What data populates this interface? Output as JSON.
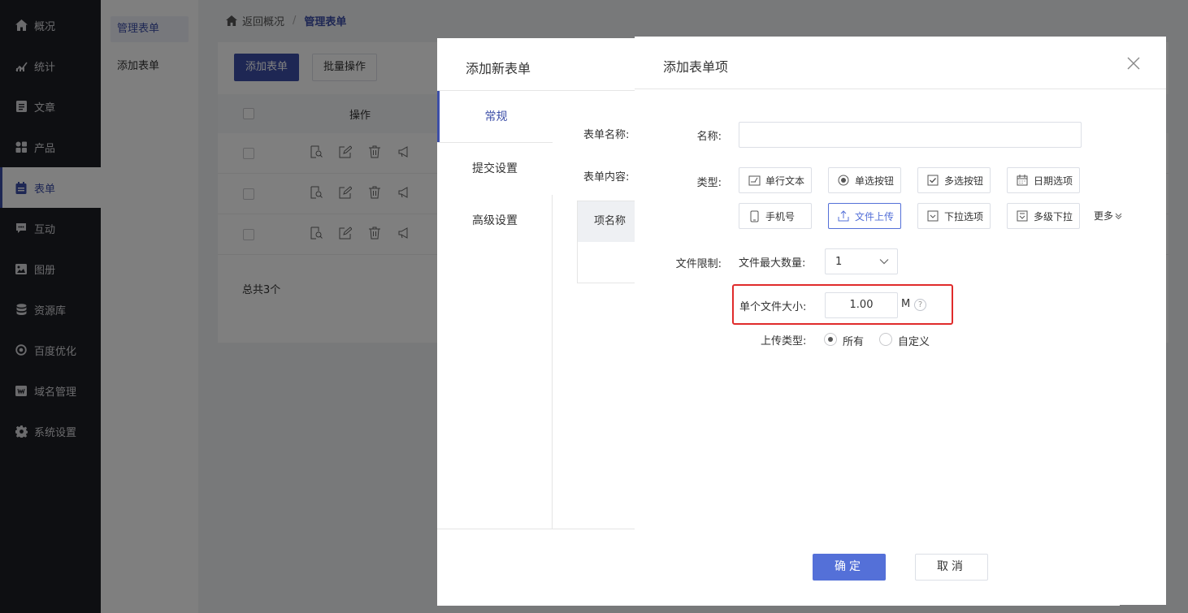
{
  "nav": {
    "items": [
      {
        "label": "概况",
        "icon": "home-icon"
      },
      {
        "label": "统计",
        "icon": "chart-icon"
      },
      {
        "label": "文章",
        "icon": "article-icon"
      },
      {
        "label": "产品",
        "icon": "product-icon"
      },
      {
        "label": "表单",
        "icon": "form-icon",
        "active": true
      },
      {
        "label": "互动",
        "icon": "chat-icon"
      },
      {
        "label": "图册",
        "icon": "gallery-icon"
      },
      {
        "label": "资源库",
        "icon": "database-icon"
      },
      {
        "label": "百度优化",
        "icon": "seo-icon"
      },
      {
        "label": "域名管理",
        "icon": "domain-icon"
      },
      {
        "label": "系统设置",
        "icon": "gear-icon"
      }
    ]
  },
  "subnav": {
    "items": [
      {
        "label": "管理表单",
        "active": true
      },
      {
        "label": "添加表单"
      }
    ]
  },
  "breadcrumb": {
    "back": "返回概况",
    "sep": "/",
    "current": "管理表单"
  },
  "toolbar": {
    "add_label": "添加表单",
    "batch_label": "批量操作"
  },
  "table": {
    "col_action": "操作",
    "row_count": 3,
    "total": "总共3个"
  },
  "dialog1": {
    "title": "添加新表单",
    "tabs": [
      "常规",
      "提交设置",
      "高级设置"
    ],
    "form_name_label": "表单名称:",
    "form_content_label": "表单内容:",
    "item_name_header": "项名称"
  },
  "dialog2": {
    "title": "添加表单项",
    "name_label": "名称:",
    "name_value": "",
    "type_label": "类型:",
    "types": [
      {
        "label": "单行文本",
        "icon": "text-line-icon"
      },
      {
        "label": "单选按钮",
        "icon": "radio-icon"
      },
      {
        "label": "多选按钮",
        "icon": "checkbox-icon"
      },
      {
        "label": "日期选项",
        "icon": "calendar-icon"
      },
      {
        "label": "手机号",
        "icon": "phone-icon"
      },
      {
        "label": "文件上传",
        "icon": "upload-icon",
        "active": true
      },
      {
        "label": "下拉选项",
        "icon": "dropdown-icon"
      },
      {
        "label": "多级下拉",
        "icon": "multilevel-dropdown-icon"
      }
    ],
    "more_label": "更多",
    "file_limit_label": "文件限制:",
    "max_count_label": "文件最大数量:",
    "max_count_value": "1",
    "file_size_label": "单个文件大小:",
    "file_size_value": "1.00",
    "file_size_unit": "M",
    "help_mark": "?",
    "upload_type_label": "上传类型:",
    "upload_type_options": [
      {
        "label": "所有",
        "checked": true
      },
      {
        "label": "自定义",
        "checked": false
      }
    ],
    "ok_label": "确定",
    "cancel_label": "取消"
  },
  "colors": {
    "accent": "#3d4fa8",
    "primary_button": "#5470d8",
    "highlight_border": "#e02b2b",
    "nav_bg": "#1d1e24"
  }
}
